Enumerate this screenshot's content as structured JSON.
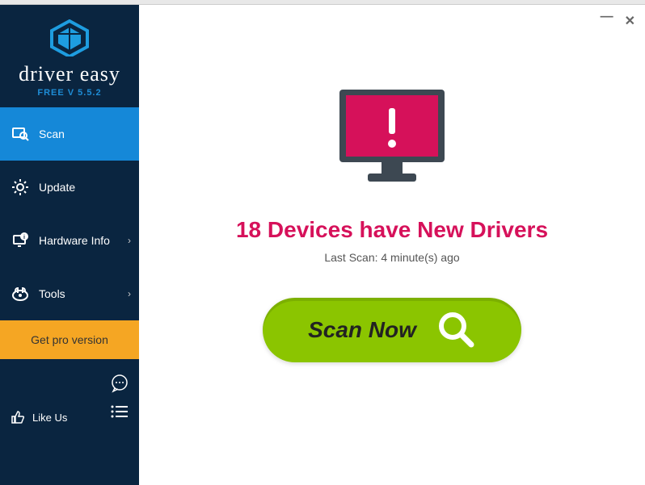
{
  "app": {
    "name": "driver easy",
    "version_label": "FREE V 5.5.2"
  },
  "sidebar": {
    "items": [
      {
        "label": "Scan",
        "icon": "scan-icon",
        "active": true,
        "chevron": false
      },
      {
        "label": "Update",
        "icon": "gear-icon",
        "active": false,
        "chevron": false
      },
      {
        "label": "Hardware Info",
        "icon": "hardware-icon",
        "active": false,
        "chevron": true
      },
      {
        "label": "Tools",
        "icon": "tools-icon",
        "active": false,
        "chevron": true
      }
    ],
    "pro_label": "Get pro version",
    "like_label": "Like Us"
  },
  "main": {
    "headline": "18 Devices have New Drivers",
    "last_scan": "Last Scan: 4 minute(s) ago",
    "scan_button": "Scan Now"
  },
  "colors": {
    "sidebar_bg": "#0a2540",
    "active_bg": "#1588d8",
    "pro_bg": "#f5a623",
    "headline": "#d6115a",
    "scan_btn": "#8bc500"
  }
}
